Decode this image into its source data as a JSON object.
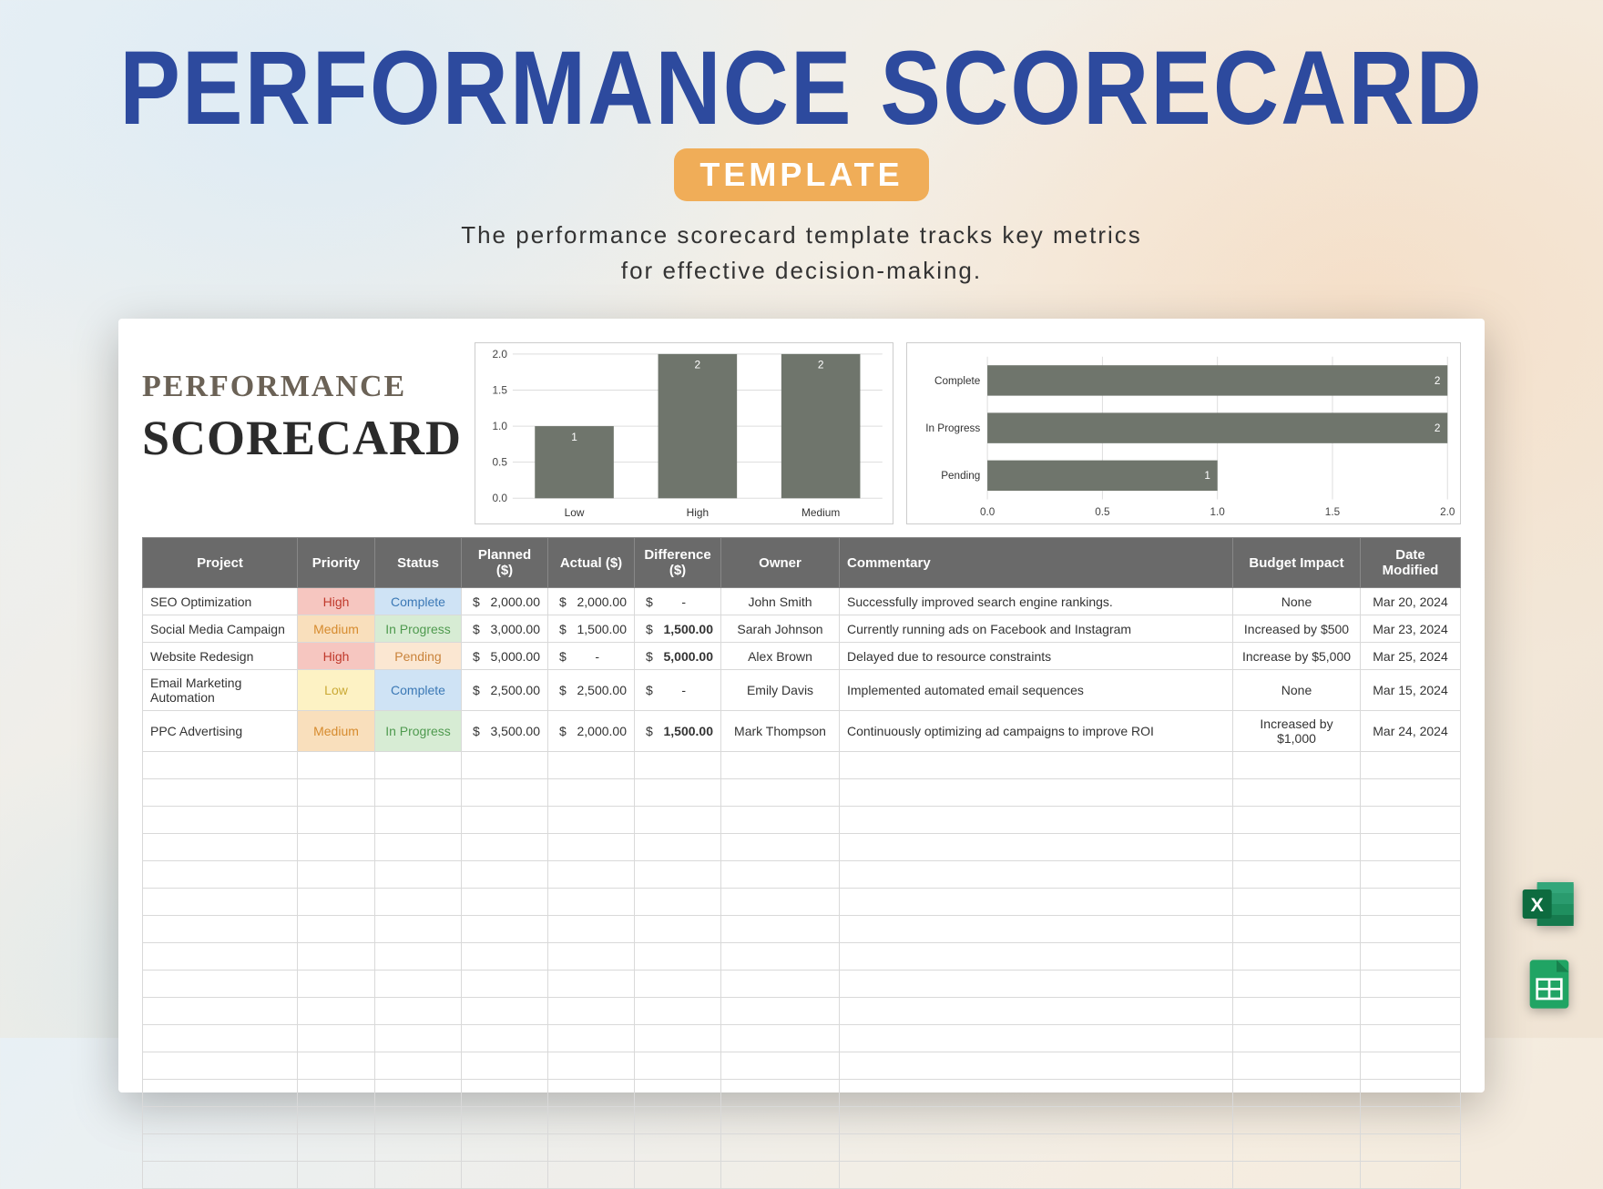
{
  "hero": {
    "title": "PERFORMANCE SCORECARD",
    "badge": "TEMPLATE",
    "subtitle_l1": "The performance scorecard template tracks key metrics",
    "subtitle_l2": "for effective decision-making."
  },
  "brand": {
    "line1": "PERFORMANCE",
    "line2": "SCORECARD"
  },
  "columns": {
    "project": "Project",
    "priority": "Priority",
    "status": "Status",
    "planned": "Planned ($)",
    "actual": "Actual ($)",
    "diff": "Difference ($)",
    "owner": "Owner",
    "commentary": "Commentary",
    "impact": "Budget Impact",
    "date": "Date Modified"
  },
  "rows": [
    {
      "project": "SEO Optimization",
      "priority": "High",
      "status": "Complete",
      "planned": "2,000.00",
      "actual": "2,000.00",
      "diff": "-",
      "owner": "John Smith",
      "commentary": "Successfully improved search engine rankings.",
      "impact": "None",
      "date": "Mar 20, 2024"
    },
    {
      "project": "Social Media Campaign",
      "priority": "Medium",
      "status": "In Progress",
      "planned": "3,000.00",
      "actual": "1,500.00",
      "diff": "1,500.00",
      "owner": "Sarah Johnson",
      "commentary": "Currently running ads on Facebook and Instagram",
      "impact": "Increased by $500",
      "date": "Mar 23, 2024"
    },
    {
      "project": "Website Redesign",
      "priority": "High",
      "status": "Pending",
      "planned": "5,000.00",
      "actual": "-",
      "diff": "5,000.00",
      "owner": "Alex Brown",
      "commentary": "Delayed due to resource constraints",
      "impact": "Increase by $5,000",
      "date": "Mar 25, 2024"
    },
    {
      "project": "Email Marketing Automation",
      "priority": "Low",
      "status": "Complete",
      "planned": "2,500.00",
      "actual": "2,500.00",
      "diff": "-",
      "owner": "Emily Davis",
      "commentary": "Implemented automated email sequences",
      "impact": "None",
      "date": "Mar 15, 2024"
    },
    {
      "project": "PPC Advertising",
      "priority": "Medium",
      "status": "In Progress",
      "planned": "3,500.00",
      "actual": "2,000.00",
      "diff": "1,500.00",
      "owner": "Mark Thompson",
      "commentary": "Continuously optimizing ad campaigns to improve ROI",
      "impact": "Increased by $1,000",
      "date": "Mar 24, 2024"
    }
  ],
  "chart_data": [
    {
      "type": "bar",
      "orientation": "vertical",
      "title": "",
      "xlabel": "",
      "ylabel": "",
      "ylim": [
        0,
        2
      ],
      "yticks": [
        0.0,
        0.5,
        1.0,
        1.5,
        2.0
      ],
      "categories": [
        "Low",
        "High",
        "Medium"
      ],
      "values": [
        1,
        2,
        2
      ],
      "bar_color": "#6f756c"
    },
    {
      "type": "bar",
      "orientation": "horizontal",
      "title": "",
      "xlabel": "",
      "ylabel": "",
      "xlim": [
        0,
        2
      ],
      "xticks": [
        0.0,
        0.5,
        1.0,
        1.5,
        2.0
      ],
      "categories": [
        "Complete",
        "In Progress",
        "Pending"
      ],
      "values": [
        2,
        2,
        1
      ],
      "bar_color": "#6f756c"
    }
  ],
  "icons": {
    "excel": "Excel",
    "sheets": "Google Sheets"
  }
}
